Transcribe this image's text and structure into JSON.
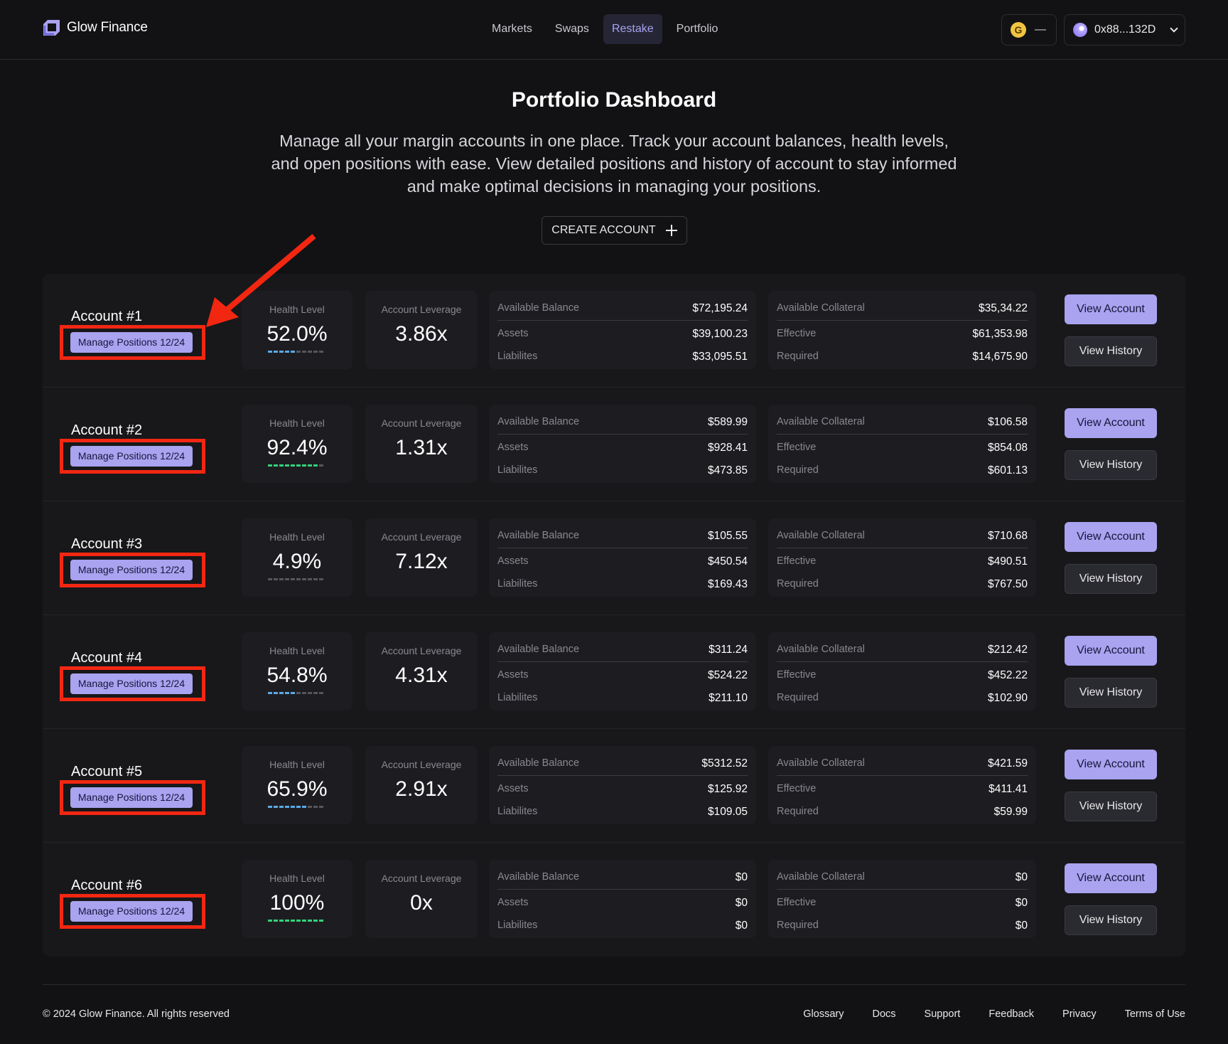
{
  "header": {
    "brand": "Glow Finance",
    "nav": [
      "Markets",
      "Swaps",
      "Restake",
      "Portfolio"
    ],
    "active_nav": "Restake",
    "token": {
      "icon": "G",
      "value": "—"
    },
    "wallet": {
      "address": "0x88...132D"
    }
  },
  "hero": {
    "title": "Portfolio Dashboard",
    "description": "Manage all your margin accounts in one place. Track your account balances, health levels, and open positions with ease. View detailed positions and history of account to stay informed and make optimal decisions in managing your positions.",
    "create_label": "CREATE ACCOUNT"
  },
  "labels": {
    "health": "Health Level",
    "leverage": "Account Leverage",
    "available_balance": "Available Balance",
    "assets": "Assets",
    "liabilities": "Liabilites",
    "available_collateral": "Available Collateral",
    "effective": "Effective",
    "required": "Required",
    "view_account": "View Account",
    "view_history": "View History",
    "manage": "Manage Positions 12/24"
  },
  "accounts": [
    {
      "name": "Account #1",
      "health": "52.0%",
      "health_pct": 52.0,
      "leverage": "3.86x",
      "available_balance": "$72,195.24",
      "assets": "$39,100.23",
      "liabilities": "$33,095.51",
      "available_collateral": "$35,34.22",
      "effective": "$61,353.98",
      "required": "$14,675.90"
    },
    {
      "name": "Account #2",
      "health": "92.4%",
      "health_pct": 92.4,
      "leverage": "1.31x",
      "available_balance": "$589.99",
      "assets": "$928.41",
      "liabilities": "$473.85",
      "available_collateral": "$106.58",
      "effective": "$854.08",
      "required": "$601.13"
    },
    {
      "name": "Account #3",
      "health": "4.9%",
      "health_pct": 4.9,
      "leverage": "7.12x",
      "available_balance": "$105.55",
      "assets": "$450.54",
      "liabilities": "$169.43",
      "available_collateral": "$710.68",
      "effective": "$490.51",
      "required": "$767.50"
    },
    {
      "name": "Account #4",
      "health": "54.8%",
      "health_pct": 54.8,
      "leverage": "4.31x",
      "available_balance": "$311.24",
      "assets": "$524.22",
      "liabilities": "$211.10",
      "available_collateral": "$212.42",
      "effective": "$452.22",
      "required": "$102.90"
    },
    {
      "name": "Account #5",
      "health": "65.9%",
      "health_pct": 65.9,
      "leverage": "2.91x",
      "available_balance": "$5312.52",
      "assets": "$125.92",
      "liabilities": "$109.05",
      "available_collateral": "$421.59",
      "effective": "$411.41",
      "required": "$59.99"
    },
    {
      "name": "Account #6",
      "health": "100%",
      "health_pct": 100,
      "leverage": "0x",
      "available_balance": "$0",
      "assets": "$0",
      "liabilities": "$0",
      "available_collateral": "$0",
      "effective": "$0",
      "required": "$0"
    }
  ],
  "colors": {
    "accent": "#a9a3f0",
    "health_blue": "#5aa9e6",
    "health_green": "#34d17a",
    "health_red": "#e5484d",
    "annotation_red": "#f22712"
  },
  "footer": {
    "copyright": "© 2024 Glow Finance. All rights reserved",
    "links": [
      "Glossary",
      "Docs",
      "Support",
      "Feedback",
      "Privacy",
      "Terms of Use"
    ]
  }
}
